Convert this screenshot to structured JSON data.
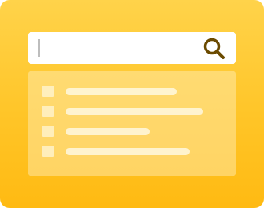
{
  "search": {
    "value": "",
    "placeholder": "",
    "icon": "magnifier-icon",
    "icon_color": "#6b4a00"
  },
  "results": {
    "rows": [
      {
        "checked": false,
        "fill": 0.66
      },
      {
        "checked": false,
        "fill": 0.82
      },
      {
        "checked": false,
        "fill": 0.5
      },
      {
        "checked": false,
        "fill": 0.74
      }
    ]
  },
  "colors": {
    "background_top": "#ffd34a",
    "background_bottom": "#ffba12",
    "search_bar": "#ffffff"
  }
}
